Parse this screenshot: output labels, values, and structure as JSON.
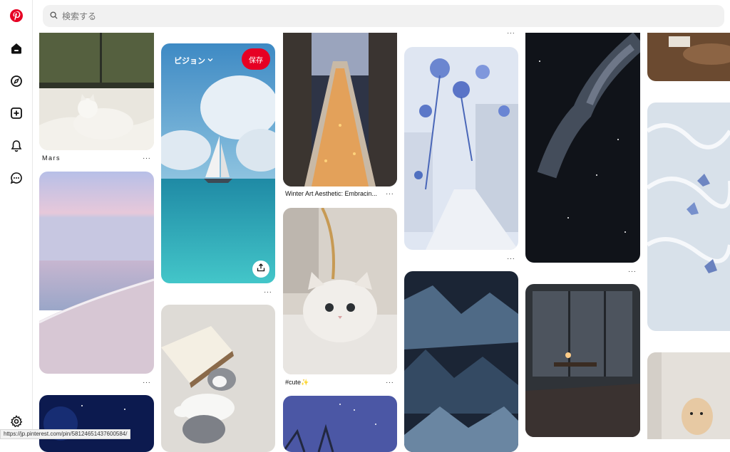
{
  "search": {
    "placeholder": "検索する"
  },
  "sidebar": {
    "items": [
      "logo-icon",
      "home-icon",
      "explore-icon",
      "create-icon",
      "notifications-icon",
      "messages-icon",
      "settings-icon"
    ]
  },
  "colors": {
    "brand": "#e60023",
    "search_bg": "#f1f1f1"
  },
  "pins": {
    "c1p1": {
      "caption": "Mars",
      "more": "···"
    },
    "c1p2": {
      "more": "···"
    },
    "c2p1": {
      "board_label": "ピジョン",
      "save_label": "保存",
      "more": "···"
    },
    "c3p1": {
      "caption": "Winter Art Aesthetic: Embracin...",
      "more": "···"
    },
    "c3p2": {
      "caption": "#cute✨",
      "more": "···"
    },
    "c4p0": {
      "more": "···"
    },
    "c4p1": {
      "more": "···"
    },
    "c5p1": {
      "more": "···"
    }
  },
  "status_url": "https://jp.pinterest.com/pin/58124651437600584/"
}
